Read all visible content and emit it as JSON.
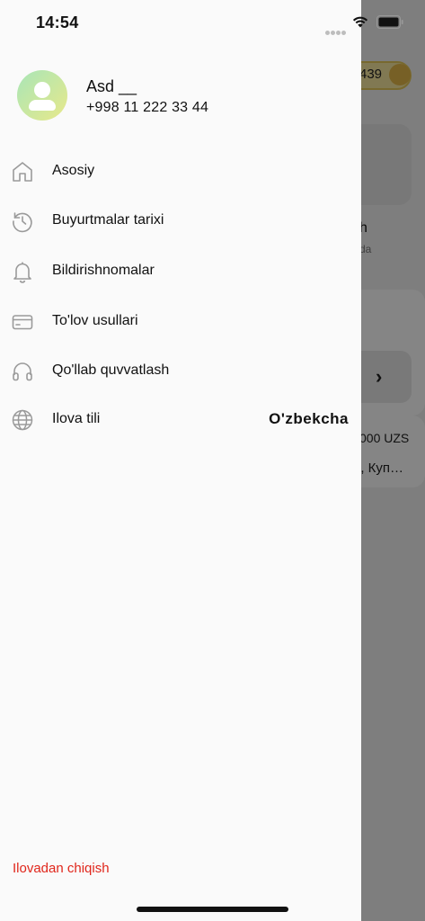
{
  "status_bar": {
    "time": "14:54"
  },
  "background": {
    "coin_count": "439",
    "card_title": "h",
    "card_subtitle": "da",
    "arrow": "›",
    "price": "000 UZS",
    "names": "і,  Куп…"
  },
  "profile": {
    "name": "Asd __",
    "phone": "+998 11 222 33 44"
  },
  "menu": [
    {
      "label": "Asosiy",
      "icon": "home-icon"
    },
    {
      "label": "Buyurtmalar tarixi",
      "icon": "history-icon"
    },
    {
      "label": "Bildirishnomalar",
      "icon": "bell-icon"
    },
    {
      "label": "To'lov usullari",
      "icon": "credit-card-icon"
    },
    {
      "label": "Qo'llab quvvatlash",
      "icon": "headphones-icon"
    },
    {
      "label": "Ilova tili",
      "icon": "globe-icon",
      "value": "O'zbekcha"
    }
  ],
  "logout_label": "Ilovadan chiqish",
  "colors": {
    "logout": "#e0261b",
    "drawer_bg": "#fafafa",
    "icon_stroke": "#9a9a9a"
  }
}
